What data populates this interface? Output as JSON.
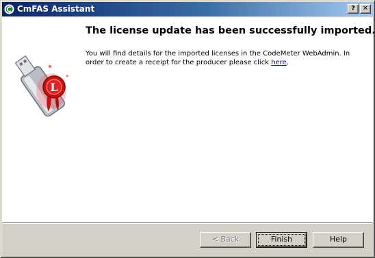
{
  "window": {
    "title": "CmFAS Assistant",
    "help_button": "?",
    "close_button": "✕"
  },
  "content": {
    "heading": "The license update has been successfully imported.",
    "body_text": "You will find details for the imported licenses in the CodeMeter WebAdmin. In order to create a receipt for the producer please click ",
    "link_text": "here",
    "body_end": ".",
    "illustration_icon": "usb-license-seal-icon",
    "seal_letter": "L"
  },
  "buttons": {
    "back": "< Back",
    "finish": "Finish",
    "help": "Help"
  },
  "colors": {
    "titlebar_start": "#0a246a",
    "titlebar_end": "#a6caf0",
    "face": "#d4d0c8",
    "link": "#0000cc",
    "seal": "#cc1111"
  }
}
